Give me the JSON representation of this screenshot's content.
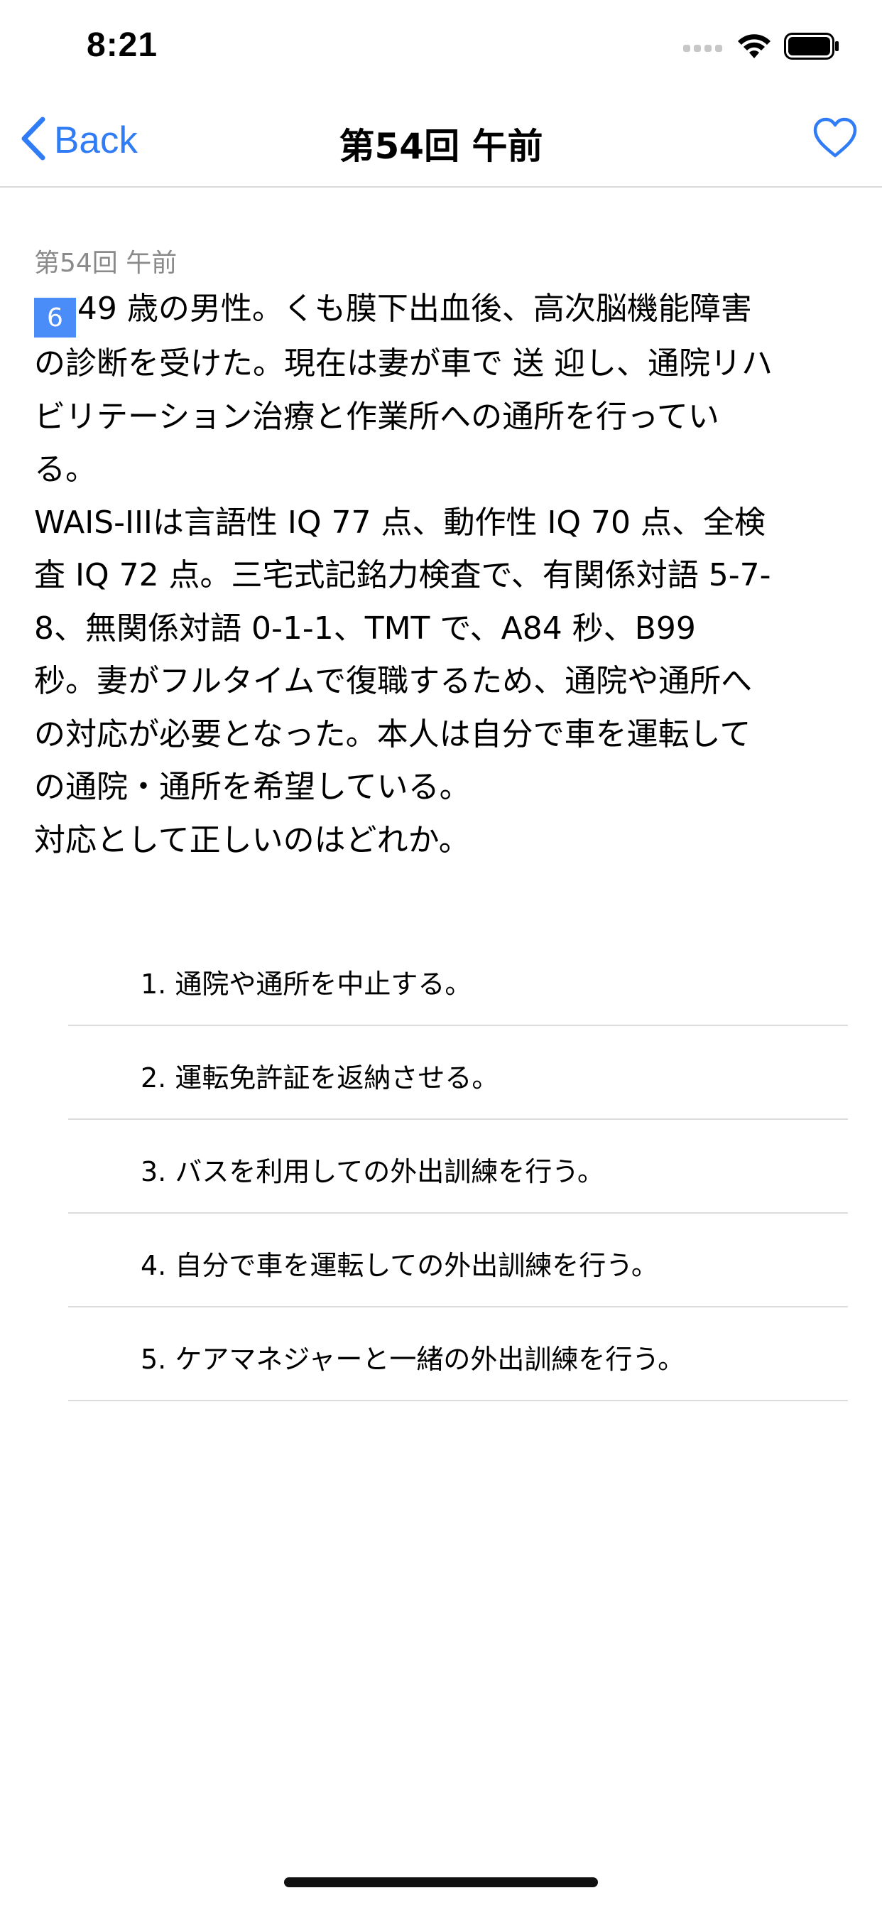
{
  "status_bar": {
    "time": "8:21",
    "icons": [
      "cellular-signal-icon",
      "wifi-icon",
      "battery-icon"
    ]
  },
  "nav": {
    "back_label": "Back",
    "title": "第54回 午前",
    "icons": [
      "chevron-left-icon",
      "heart-icon"
    ]
  },
  "question": {
    "exam_label": "第54回 午前",
    "number": "6",
    "lines": [
      "49 歳の男性。くも膜下出血後、高次脳機能障害",
      "の診断を受けた。現在は妻が車で 送 迎し、通院リハ",
      "ビリテーション治療と作業所への通所を行ってい",
      "る。",
      "WAIS-IIIは言語性 IQ 77 点、動作性 IQ 70 点、全検",
      "査 IQ 72 点。三宅式記銘力検査で、有関係対語 5-7-",
      "8、無関係対語 0-1-1、TMT で、A84 秒、B99",
      "秒。妻がフルタイムで復職するため、通院や通所へ",
      "の対応が必要となった。本人は自分で車を運転して",
      "の通院・通所を希望している。",
      "対応として正しいのはどれか。"
    ]
  },
  "choices": [
    "1. 通院や通所を中止する。",
    "2. 運転免許証を返納させる。",
    "3. バスを利用しての外出訓練を行う。",
    "4. 自分で車を運転しての外出訓練を行う。",
    "5. ケアマネジャーと一緒の外出訓練を行う。"
  ],
  "colors": {
    "accent": "#2f7cf6",
    "badge": "#4a8df8",
    "separator": "#dcdcdc",
    "secondary_text": "#8a8a8a"
  }
}
